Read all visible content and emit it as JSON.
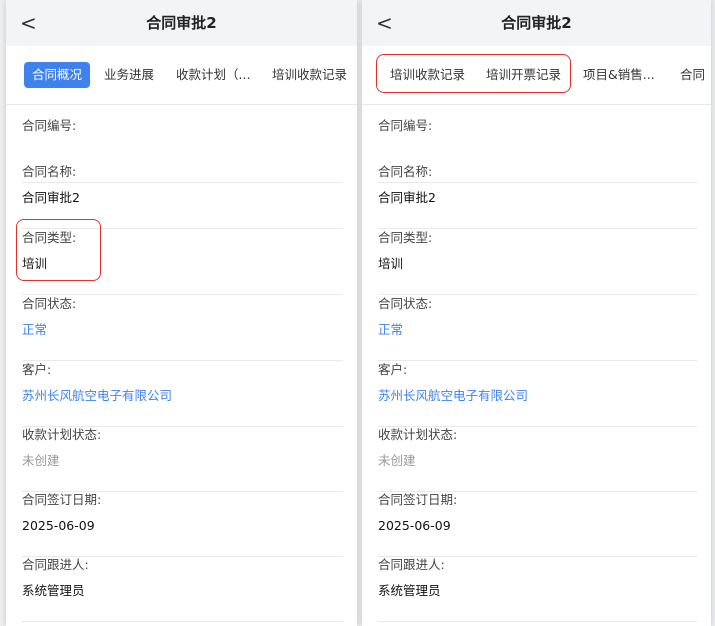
{
  "header": {
    "back_glyph": "<",
    "title": "合同审批2"
  },
  "left_panel": {
    "tabs": [
      {
        "label": "合同概况",
        "active": true
      },
      {
        "label": "业务进展"
      },
      {
        "label": "收款计划（..."
      },
      {
        "label": "培训收款记录"
      }
    ],
    "fields": [
      {
        "label": "合同编号:",
        "value": ""
      },
      {
        "label": "合同名称:",
        "value": "合同审批2"
      },
      {
        "label": "合同类型:",
        "value": "培训"
      },
      {
        "label": "合同状态:",
        "value": "正常",
        "style": "link"
      },
      {
        "label": "客户:",
        "value": "苏州长风航空电子有限公司",
        "style": "link"
      },
      {
        "label": "收款计划状态:",
        "value": "未创建",
        "style": "muted"
      },
      {
        "label": "合同签订日期:",
        "value": "2025-06-09"
      },
      {
        "label": "合同跟进人:",
        "value": "系统管理员"
      }
    ]
  },
  "right_panel": {
    "tabs": [
      {
        "label": "培训收款记录"
      },
      {
        "label": "培训开票记录"
      },
      {
        "label": "项目&销售..."
      },
      {
        "label": "合同"
      }
    ],
    "fields": [
      {
        "label": "合同编号:",
        "value": ""
      },
      {
        "label": "合同名称:",
        "value": "合同审批2"
      },
      {
        "label": "合同类型:",
        "value": "培训"
      },
      {
        "label": "合同状态:",
        "value": "正常",
        "style": "link"
      },
      {
        "label": "客户:",
        "value": "苏州长风航空电子有限公司",
        "style": "link"
      },
      {
        "label": "收款计划状态:",
        "value": "未创建",
        "style": "muted"
      },
      {
        "label": "合同签订日期:",
        "value": "2025-06-09"
      },
      {
        "label": "合同跟进人:",
        "value": "系统管理员"
      }
    ]
  },
  "colors": {
    "accent": "#3f82ec",
    "highlight": "#e03030",
    "muted": "#999999",
    "background": "#eeeff2"
  }
}
